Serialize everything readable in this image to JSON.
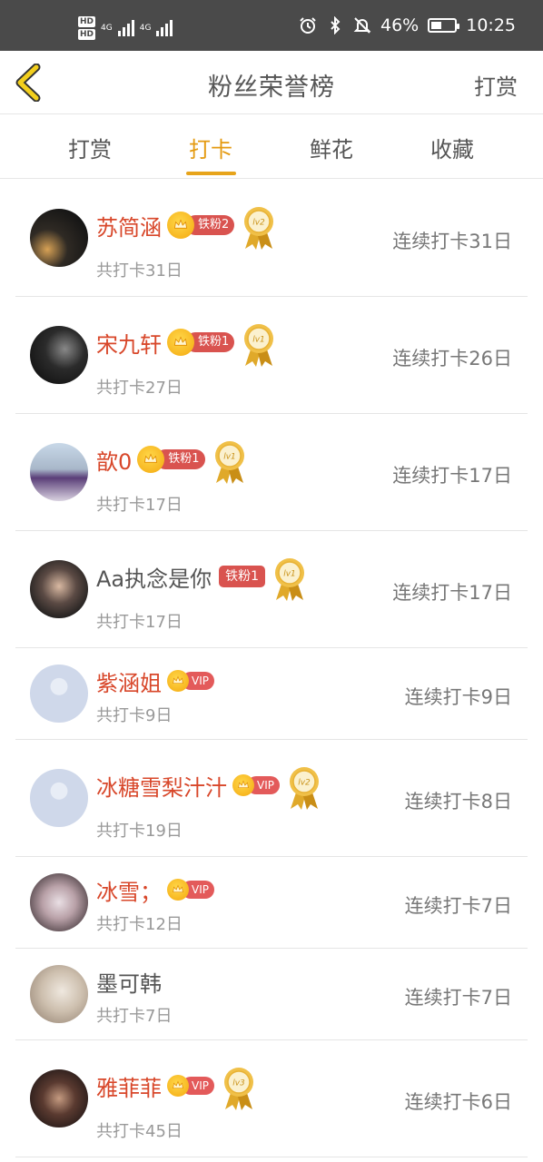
{
  "status_bar": {
    "hd1": "HD",
    "hd2": "HD",
    "net1": "4G",
    "net2": "4G",
    "battery": "46%",
    "battery_level": 0.46,
    "time": "10:25",
    "icons": [
      "alarm-icon",
      "bluetooth-icon",
      "mute-icon",
      "battery-icon"
    ]
  },
  "navbar": {
    "title": "粉丝荣誉榜",
    "action": "打赏",
    "back_icon": "chevron-left-icon"
  },
  "tabs": {
    "items": [
      {
        "label": "打赏",
        "active": false
      },
      {
        "label": "打卡",
        "active": true
      },
      {
        "label": "鲜花",
        "active": false
      },
      {
        "label": "收藏",
        "active": false
      }
    ],
    "accent": "#e49a10"
  },
  "rows": [
    {
      "name": "苏简涵",
      "name_color": "red",
      "badge_type": "fan",
      "badge_text": "铁粉2",
      "medal": "lv2",
      "total": "共打卡31日",
      "streak": "连续打卡31日",
      "avatar": "photo-night-street"
    },
    {
      "name": "宋九轩",
      "name_color": "red",
      "badge_type": "fan",
      "badge_text": "铁粉1",
      "medal": "lv1",
      "total": "共打卡27日",
      "streak": "连续打卡26日",
      "avatar": "photo-dark-figure"
    },
    {
      "name": "歆0",
      "name_color": "red",
      "badge_type": "fan",
      "badge_text": "铁粉1",
      "medal": "lv1",
      "total": "共打卡17日",
      "streak": "连续打卡17日",
      "avatar": "photo-purple-hair"
    },
    {
      "name": "Aa执念是你",
      "name_color": "gray",
      "badge_type": "plain",
      "badge_text": "铁粉1",
      "medal": "lv1",
      "total": "共打卡17日",
      "streak": "连续打卡17日",
      "avatar": "photo-portrait"
    },
    {
      "name": "紫涵姐",
      "name_color": "red",
      "badge_type": "vip",
      "badge_text": "VIP",
      "medal": "",
      "total": "共打卡9日",
      "streak": "连续打卡9日",
      "avatar": "default-avatar"
    },
    {
      "name": "冰糖雪梨汁汁",
      "name_color": "red",
      "badge_type": "vip",
      "badge_text": "VIP",
      "medal": "lv2",
      "total": "共打卡19日",
      "streak": "连续打卡8日",
      "avatar": "default-avatar"
    },
    {
      "name": "冰雪；",
      "name_color": "red",
      "badge_type": "vip",
      "badge_text": "VIP",
      "medal": "",
      "total": "共打卡12日",
      "streak": "连续打卡7日",
      "avatar": "photo-masked-girl"
    },
    {
      "name": "墨可韩",
      "name_color": "gray",
      "badge_type": "none",
      "badge_text": "",
      "medal": "",
      "total": "共打卡7日",
      "streak": "连续打卡7日",
      "avatar": "photo-blonde-hair"
    },
    {
      "name": "雅菲菲",
      "name_color": "red",
      "badge_type": "vip",
      "badge_text": "VIP",
      "medal": "lv3",
      "total": "共打卡45日",
      "streak": "连续打卡6日",
      "avatar": "photo-dark-hair-girl"
    }
  ]
}
